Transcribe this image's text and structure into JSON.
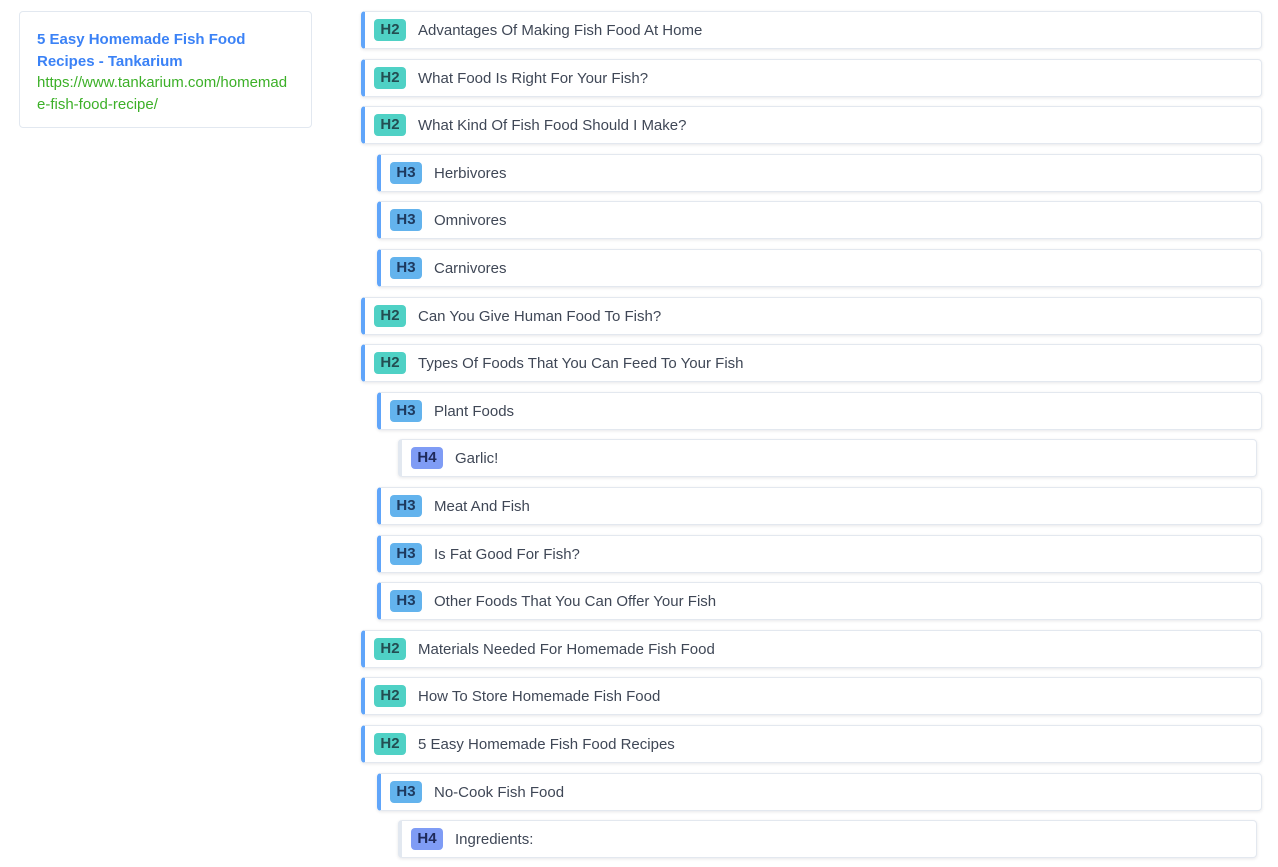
{
  "source": {
    "title": "5 Easy Homemade Fish Food Recipes - Tankarium",
    "url": "https://www.tankarium.com/homemade-fish-food-recipe/"
  },
  "colors": {
    "title_link": "#3b82f6",
    "url_link": "#3cb028",
    "h2_badge": "#4fd1c5",
    "h3_badge": "#63b3ed",
    "h4_badge": "#7f9cf5",
    "accent_border": "#60a5fa"
  },
  "outline": [
    {
      "level": "H2",
      "text": "Advantages Of Making Fish Food At Home"
    },
    {
      "level": "H2",
      "text": "What Food Is Right For Your Fish?"
    },
    {
      "level": "H2",
      "text": "What Kind Of Fish Food Should I Make?"
    },
    {
      "level": "H3",
      "text": "Herbivores"
    },
    {
      "level": "H3",
      "text": "Omnivores"
    },
    {
      "level": "H3",
      "text": "Carnivores"
    },
    {
      "level": "H2",
      "text": "Can You Give Human Food To Fish?"
    },
    {
      "level": "H2",
      "text": "Types Of Foods That You Can Feed To Your Fish"
    },
    {
      "level": "H3",
      "text": "Plant Foods"
    },
    {
      "level": "H4",
      "text": "Garlic!"
    },
    {
      "level": "H3",
      "text": "Meat And Fish"
    },
    {
      "level": "H3",
      "text": "Is Fat Good For Fish?"
    },
    {
      "level": "H3",
      "text": "Other Foods That You Can Offer Your Fish"
    },
    {
      "level": "H2",
      "text": "Materials Needed For Homemade Fish Food"
    },
    {
      "level": "H2",
      "text": "How To Store Homemade Fish Food"
    },
    {
      "level": "H2",
      "text": "5 Easy Homemade Fish Food Recipes"
    },
    {
      "level": "H3",
      "text": "No-Cook Fish Food"
    },
    {
      "level": "H4",
      "text": "Ingredients:"
    }
  ]
}
